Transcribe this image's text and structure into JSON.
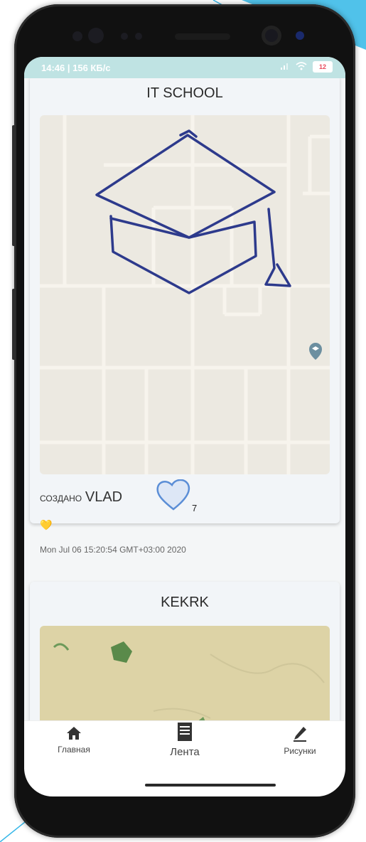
{
  "status_bar": {
    "time_speed": "14:46 | 156 КБ/с",
    "battery": "12"
  },
  "posts": [
    {
      "title": "IT SCHOOL",
      "author_prefix": "создано",
      "author": "VLAD",
      "likes": "7",
      "emoji": "💛",
      "timestamp": "Mon Jul 06 15:20:54 GMT+03:00 2020"
    },
    {
      "title": "KEKRK"
    }
  ],
  "nav": {
    "home": "Главная",
    "feed": "Лента",
    "drawings": "Рисунки"
  },
  "colors": {
    "status_bar": "#bfe3e3",
    "card": "#f2f5f8",
    "drawing_stroke": "#2d3a8c",
    "map1": "#ece9e1",
    "map2": "#ddd3a6"
  },
  "icons": [
    "heart-outline-icon",
    "home-icon",
    "feed-icon",
    "pencil-icon",
    "map-pin-icon"
  ]
}
